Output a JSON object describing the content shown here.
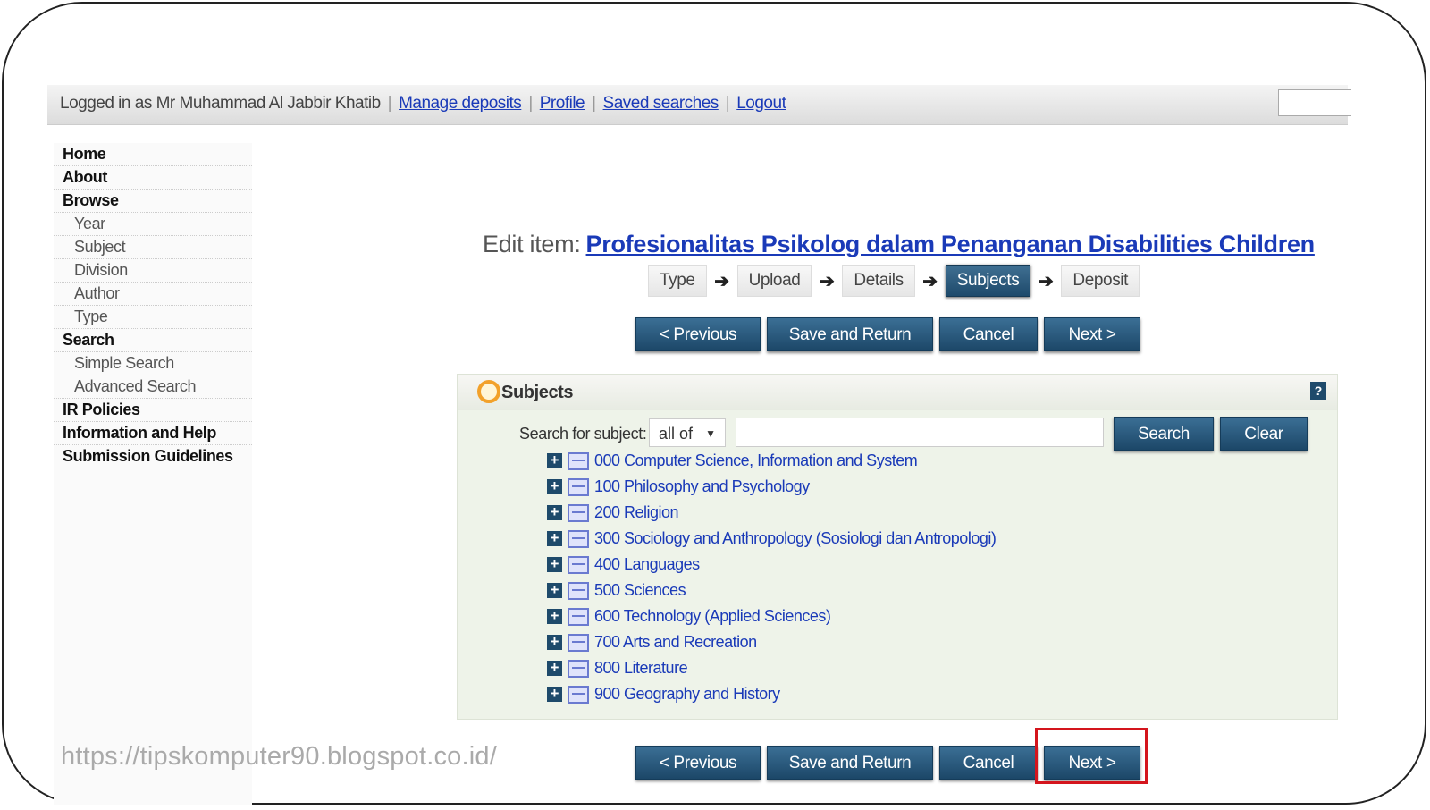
{
  "topbar": {
    "logged_in": "Logged in as Mr Muhammad Al Jabbir Khatib",
    "links": [
      "Manage deposits",
      "Profile",
      "Saved searches",
      "Logout"
    ]
  },
  "sidebar": {
    "items": [
      {
        "label": "Home",
        "level": 0
      },
      {
        "label": "About",
        "level": 0
      },
      {
        "label": "Browse",
        "level": 0
      },
      {
        "label": "Year",
        "level": 1
      },
      {
        "label": "Subject",
        "level": 1
      },
      {
        "label": "Division",
        "level": 1
      },
      {
        "label": "Author",
        "level": 1
      },
      {
        "label": "Type",
        "level": 1
      },
      {
        "label": "Search",
        "level": 0
      },
      {
        "label": "Simple Search",
        "level": 1
      },
      {
        "label": "Advanced Search",
        "level": 1
      },
      {
        "label": "IR Policies",
        "level": 0
      },
      {
        "label": "Information and Help",
        "level": 0
      },
      {
        "label": "Submission Guidelines",
        "level": 0
      }
    ]
  },
  "page": {
    "title_prefix": "Edit item:",
    "item_title": "Profesionalitas Psikolog dalam Penanganan Disabilities Children"
  },
  "steps": [
    "Type",
    "Upload",
    "Details",
    "Subjects",
    "Deposit"
  ],
  "active_step": "Subjects",
  "buttons": {
    "previous": "< Previous",
    "save_return": "Save and Return",
    "cancel": "Cancel",
    "next": "Next >"
  },
  "subjects_panel": {
    "title": "Subjects",
    "search_label": "Search for subject:",
    "match_select": "all of",
    "search_button": "Search",
    "clear_button": "Clear",
    "help": "?",
    "tree": [
      "000 Computer Science, Information and System",
      "100 Philosophy and Psychology",
      "200 Religion",
      "300 Sociology and Anthropology (Sosiologi dan Antropologi)",
      "400 Languages",
      "500 Sciences",
      "600 Technology (Applied Sciences)",
      "700 Arts and Recreation",
      "800 Literature",
      "900 Geography and History"
    ]
  },
  "watermark": "https://tipskomputer90.blogspot.co.id/",
  "colors": {
    "button_blue": "#1e4a6b",
    "link_blue": "#1a3ab8",
    "panel_bg": "#eef3e9",
    "highlight_red": "#d4151d"
  }
}
